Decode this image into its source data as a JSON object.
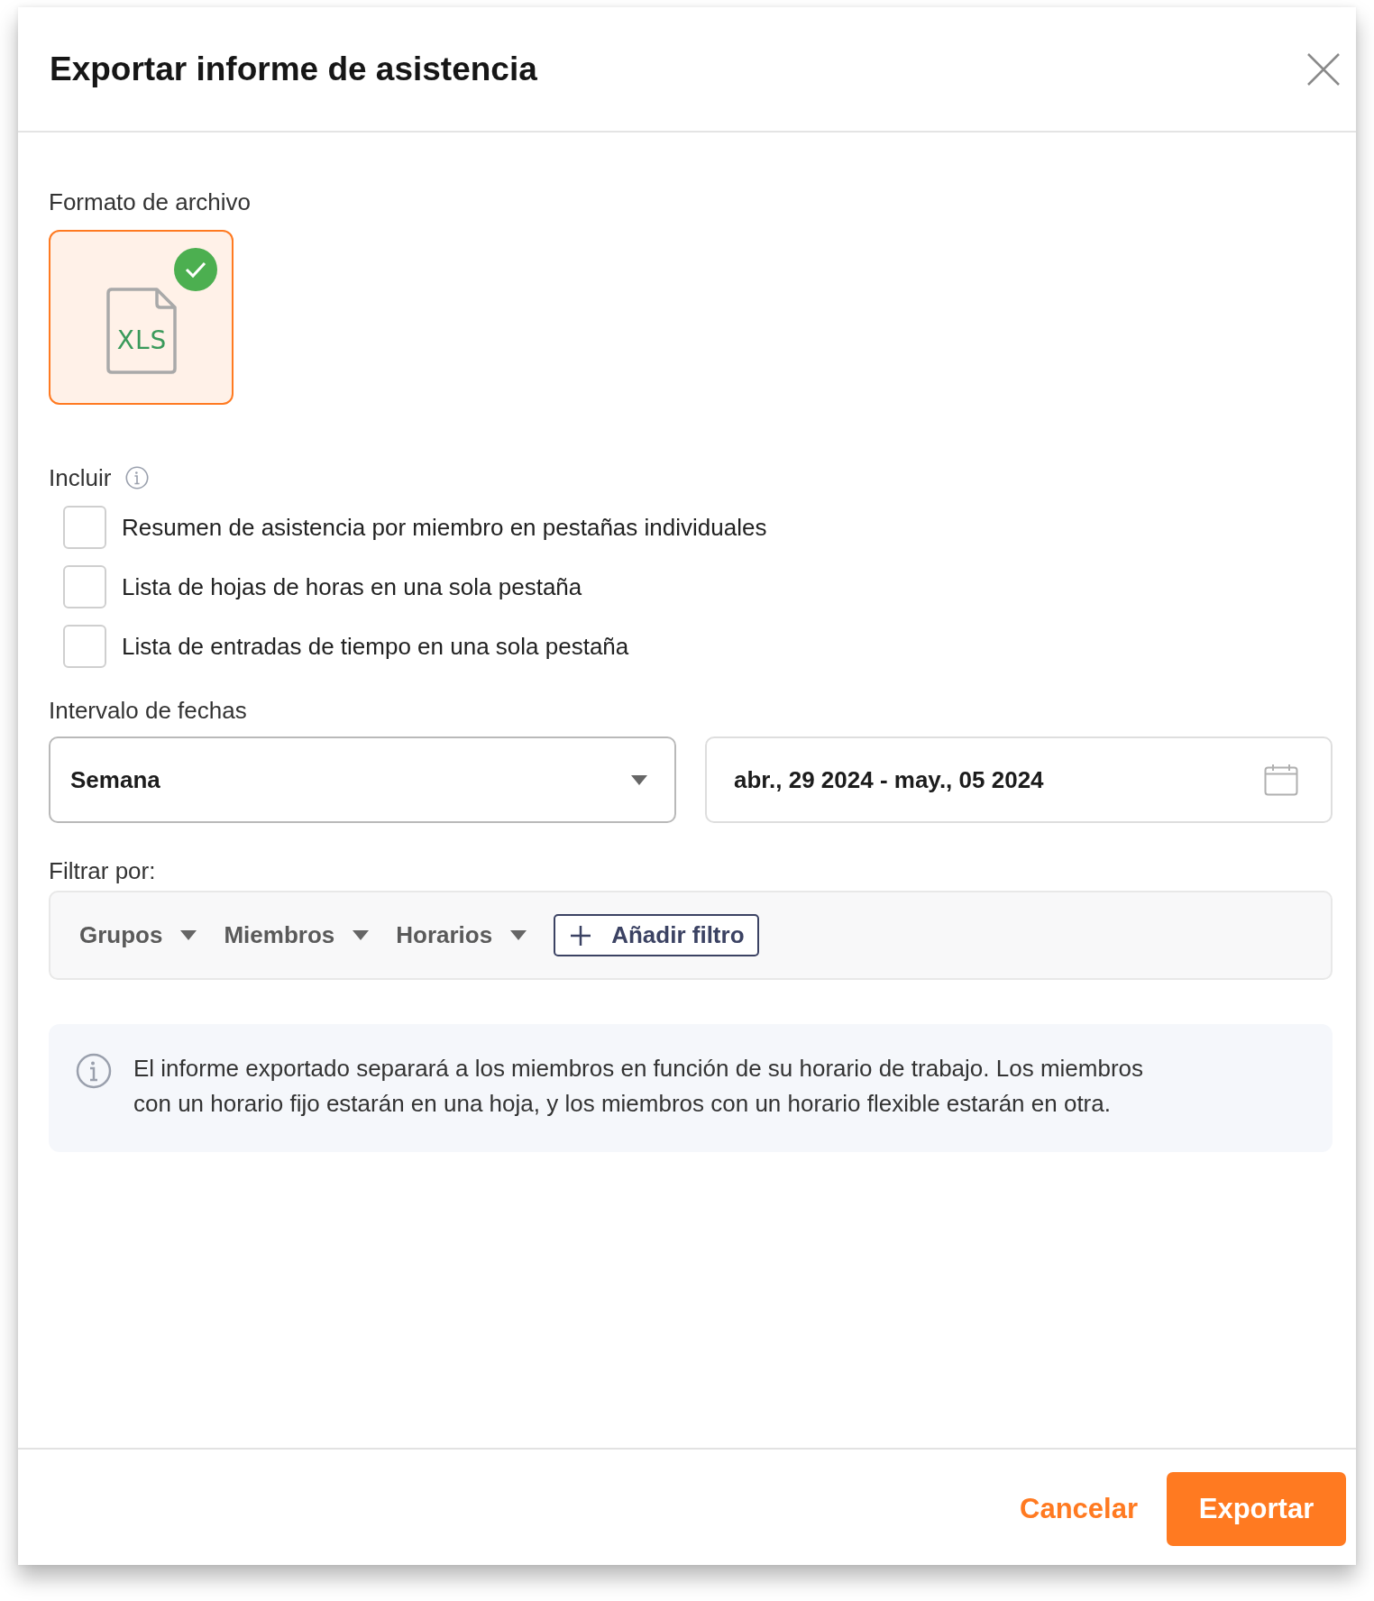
{
  "dialog": {
    "title": "Exportar informe de asistencia"
  },
  "file_format": {
    "label": "Formato de archivo",
    "options": [
      {
        "type_label": "XLS",
        "selected": true
      }
    ]
  },
  "include": {
    "label": "Incluir",
    "options": [
      {
        "label": "Resumen de asistencia por miembro en pestañas individuales",
        "checked": false
      },
      {
        "label": "Lista de hojas de horas en una sola pestaña",
        "checked": false
      },
      {
        "label": "Lista de entradas de tiempo en una sola pestaña",
        "checked": false
      }
    ]
  },
  "date_range": {
    "label": "Intervalo de fechas",
    "period": {
      "value": "Semana"
    },
    "dates": {
      "value": "abr., 29 2024 - may., 05 2024"
    }
  },
  "filter": {
    "label": "Filtrar por:",
    "items": [
      {
        "label": "Grupos"
      },
      {
        "label": "Miembros"
      },
      {
        "label": "Horarios"
      }
    ],
    "add_button": "Añadir filtro"
  },
  "notice": {
    "text": "El informe exportado separará a los miembros en función de su horario de trabajo. Los miembros con un horario fijo estarán en una hoja, y los miembros con un horario flexible estarán en otra."
  },
  "buttons": [
    {
      "label": "Cancelar",
      "kind": "secondary"
    },
    {
      "label": "Exportar",
      "kind": "primary"
    }
  ]
}
